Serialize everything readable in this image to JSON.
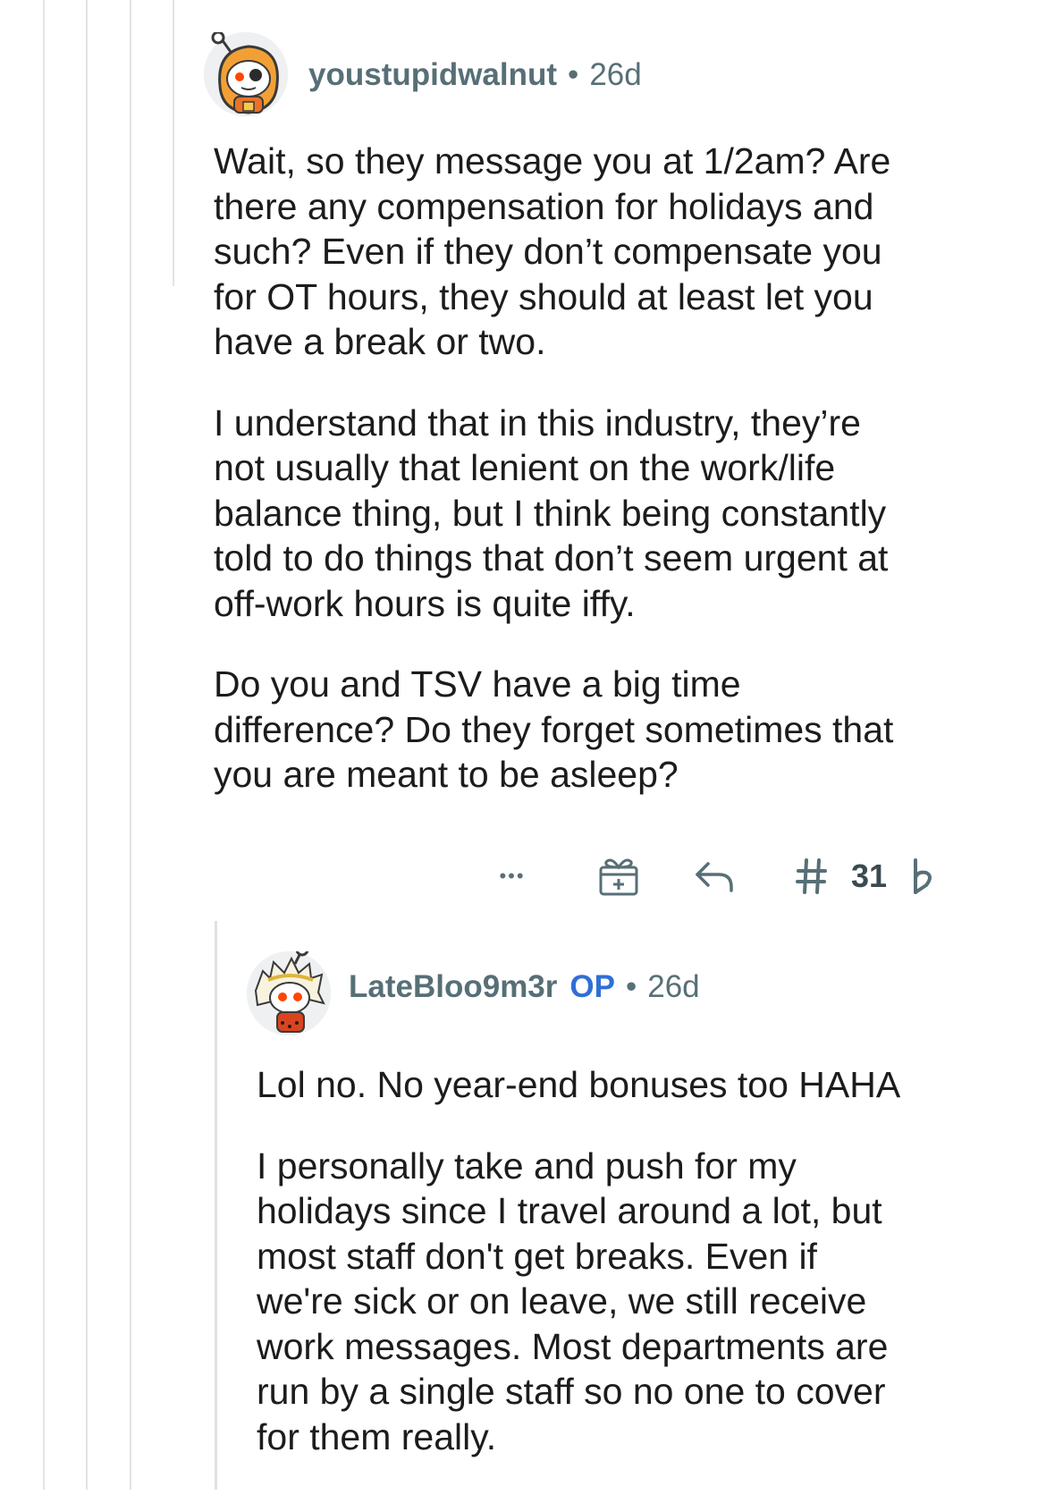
{
  "comments": [
    {
      "username": "youstupidwalnut",
      "separator": "•",
      "age": "26d",
      "paragraphs": [
        "Wait, so they message you at 1/2am? Are\nthere any compensation for holidays and\nsuch? Even if they don’t compensate you\nfor OT hours, they should at least let you\nhave a break or two.",
        "I understand that in this industry, they’re\nnot usually that lenient on the work/life\nbalance thing, but I think being constantly\ntold to do things that don’t seem urgent at\noff-work hours is quite iffy.",
        "Do you and TSV have a big time\ndifference? Do they forget sometimes that\nyou are meant to be asleep?"
      ],
      "actions": {
        "more_label": "•••",
        "vote_count": "31",
        "icons": [
          "more-icon",
          "award-icon",
          "reply-icon",
          "upvote-icon",
          "downvote-icon"
        ]
      }
    },
    {
      "username": "LateBloo9m3r",
      "op_badge": "OP",
      "separator": "•",
      "age": "26d",
      "paragraphs": [
        "Lol no. No year-end bonuses too HAHA",
        "I personally take and push for my\nholidays since I travel around a lot, but\nmost staff don't get breaks. Even if\nwe're sick or on leave, we still receive\nwork messages. Most departments are\nrun by a single staff so no one to cover\nfor them really."
      ]
    }
  ],
  "colors": {
    "text": "#1c1c1c",
    "meta": "#576f76",
    "op_badge": "#2f6fd6",
    "thread_line": "#e2e4e6"
  }
}
